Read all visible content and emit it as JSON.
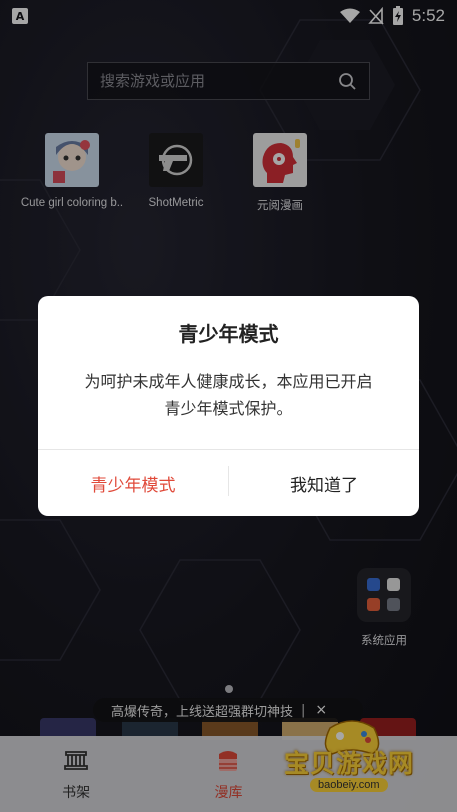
{
  "status_bar": {
    "app_indicator": "A",
    "time": "5:52"
  },
  "search": {
    "placeholder": "搜索游戏或应用"
  },
  "apps": [
    {
      "label": "Cute girl coloring b..",
      "icon": "cute-girl-coloring-icon"
    },
    {
      "label": "ShotMetric",
      "icon": "shotmetric-icon"
    },
    {
      "label": "元阅漫画",
      "icon": "yuanyue-manhua-icon"
    }
  ],
  "folder": {
    "label": "系统应用"
  },
  "dialog": {
    "title": "青少年模式",
    "message_line1": "为呵护未成年人健康成长，本应用已开启",
    "message_line2": "青少年模式保护。",
    "youth_mode_button": "青少年模式",
    "ok_button": "我知道了"
  },
  "banner": {
    "text": "高爆传奇，上线送超强群切神技",
    "separator": "|",
    "close": "×"
  },
  "tabbar": {
    "items": [
      {
        "label": "书架",
        "active": false
      },
      {
        "label": "漫库",
        "active": true
      }
    ]
  },
  "watermark": {
    "text": "宝贝游戏网",
    "url": "baobeiy.com"
  },
  "colors": {
    "accent": "#e04a3a",
    "dialog_bg": "#ffffff",
    "watermark": "#ffd43a"
  }
}
